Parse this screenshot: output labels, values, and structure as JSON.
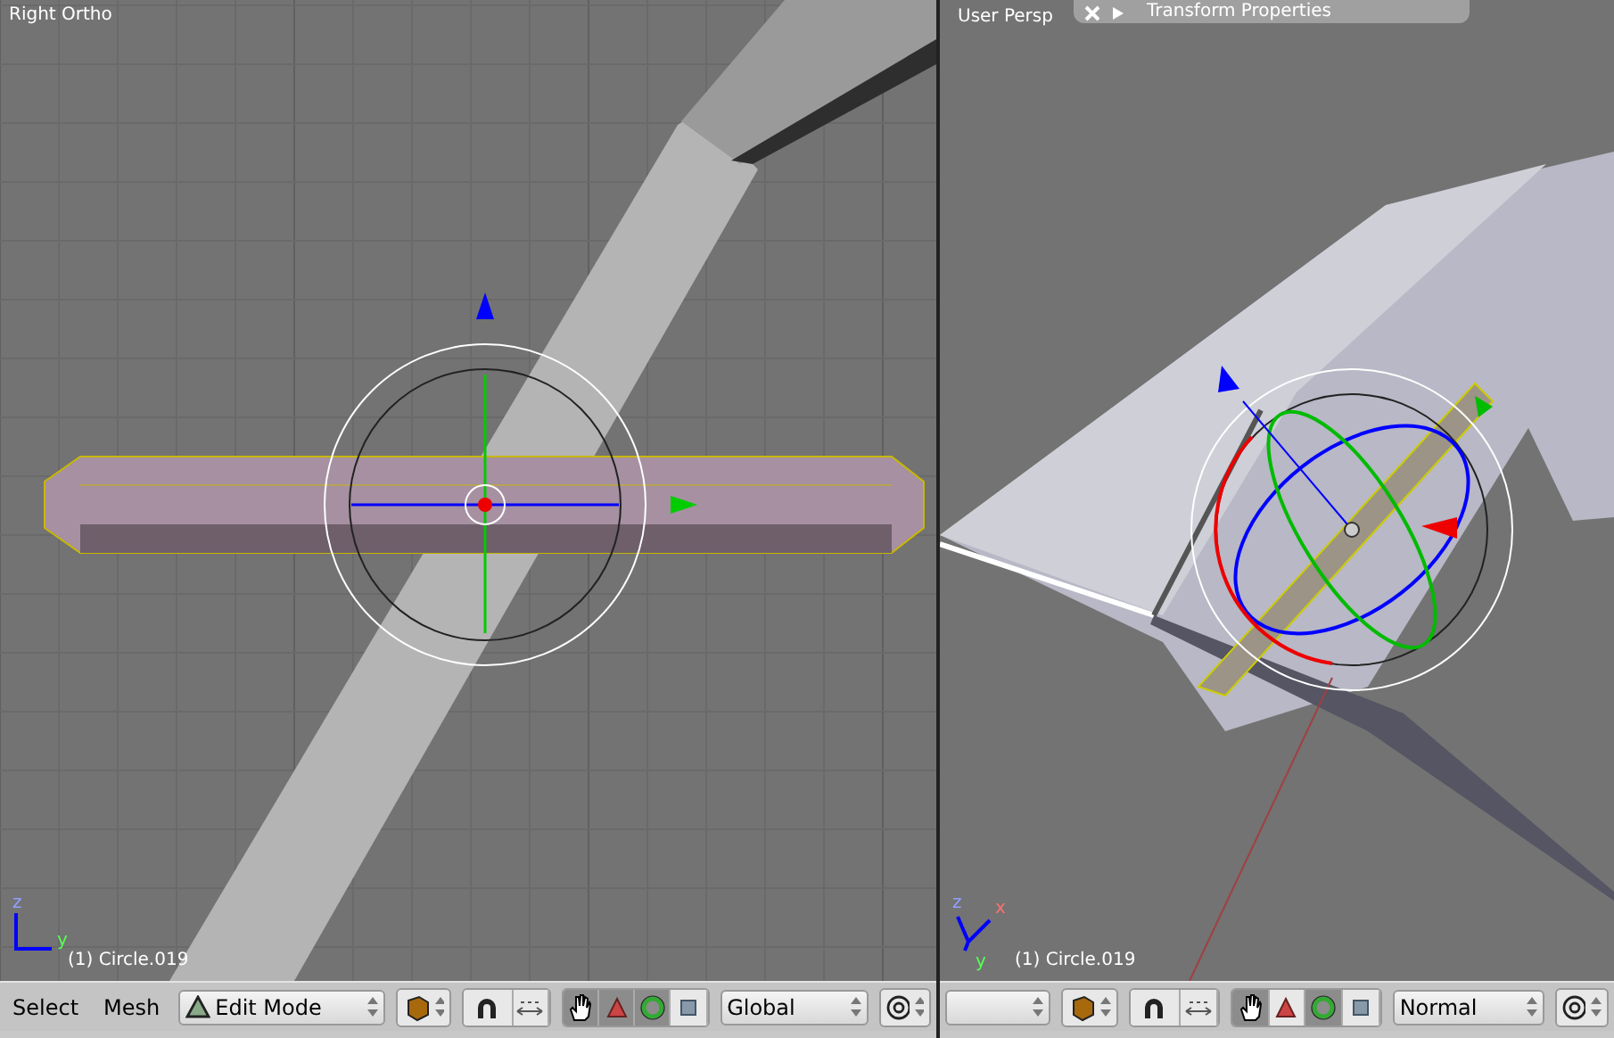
{
  "viewports": [
    {
      "kind": "ortho",
      "title": "Right Ortho",
      "object_label": "(1) Circle.019",
      "axes": [
        "z",
        "y"
      ],
      "header": {
        "menus": [
          "Select",
          "Mesh"
        ],
        "mode": "Edit Mode",
        "orientation": "Global",
        "manipulators": [
          {
            "kind": "hand",
            "selected": true
          },
          {
            "kind": "translate",
            "selected": true
          },
          {
            "kind": "rotate",
            "selected": true
          },
          {
            "kind": "scale",
            "selected": false
          }
        ]
      }
    },
    {
      "kind": "persp",
      "title": "User Persp",
      "object_label": "(1) Circle.019",
      "axes": [
        "z",
        "x",
        "y"
      ],
      "panel": {
        "title": "Transform Properties"
      },
      "header": {
        "orientation": "Normal",
        "manipulators": [
          {
            "kind": "hand",
            "selected": true
          },
          {
            "kind": "translate",
            "selected": false
          },
          {
            "kind": "rotate",
            "selected": true
          },
          {
            "kind": "scale",
            "selected": false
          }
        ]
      }
    }
  ]
}
